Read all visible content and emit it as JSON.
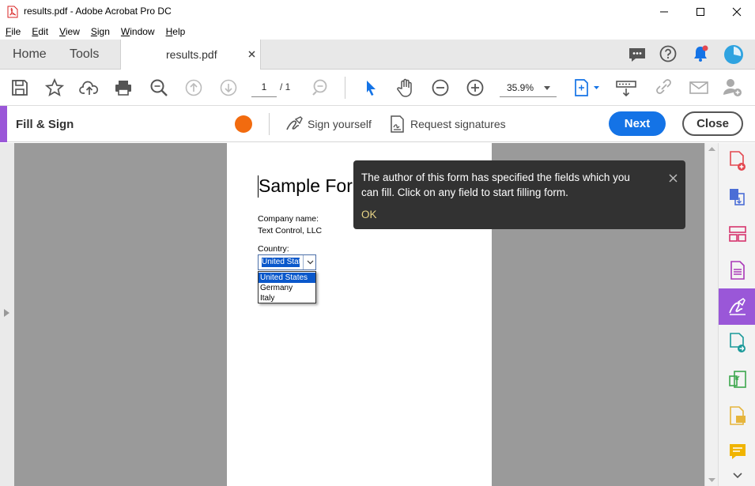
{
  "window": {
    "title": "results.pdf - Adobe Acrobat Pro DC"
  },
  "menu": [
    "File",
    "Edit",
    "View",
    "Sign",
    "Window",
    "Help"
  ],
  "tabs": {
    "home": "Home",
    "tools": "Tools",
    "document": "results.pdf"
  },
  "toolbar": {
    "page_current": "1",
    "page_total": "/ 1",
    "zoom": "35.9%"
  },
  "fillsign": {
    "title": "Fill & Sign",
    "sign_yourself": "Sign yourself",
    "request_signatures": "Request signatures",
    "next": "Next",
    "close": "Close",
    "accent": "#9a57d8",
    "dot_color": "#f26b0f"
  },
  "form": {
    "title": "Sample Form",
    "company_label": "Company name:",
    "company_value": "Text Control, LLC",
    "country_label": "Country:",
    "country_selected": "United States",
    "options": [
      "United States",
      "Germany",
      "Italy"
    ]
  },
  "tooltip": {
    "message": "The author of this form has specified the fields which you can fill. Click on any field to start filling form.",
    "ok": "OK"
  },
  "colors": {
    "primary": "#1473e6",
    "tooltip_bg": "#323232",
    "ok": "#e8d486"
  }
}
